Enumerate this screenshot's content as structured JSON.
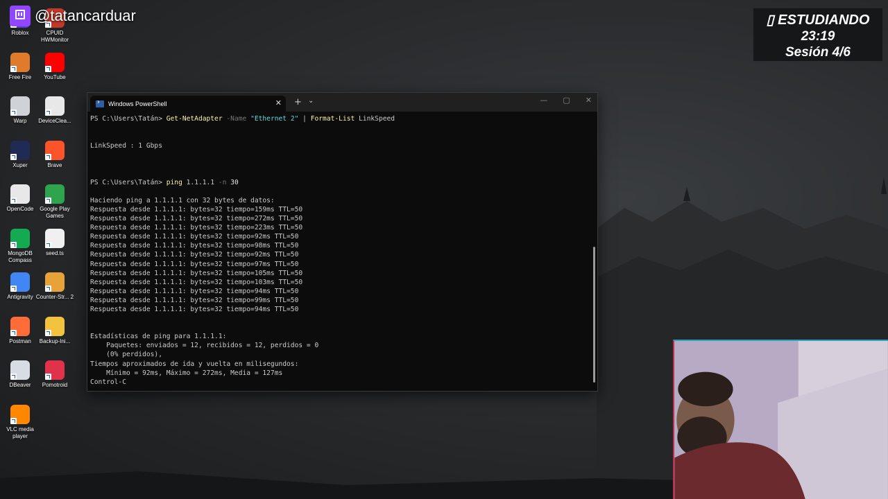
{
  "overlay": {
    "twitch_handle": "@tatancarduar",
    "status_line1": "▯ ESTUDIANDO",
    "status_time": "23:19",
    "status_session": "Sesión 4/6"
  },
  "desktop_icons": [
    {
      "label": "Roblox",
      "icon": "roblox-icon",
      "color": "#5b3fd0"
    },
    {
      "label": "CPUID HWMonitor",
      "icon": "hwmonitor-icon",
      "color": "#c0392b"
    },
    {
      "label": "Free Fire",
      "icon": "freefire-icon",
      "color": "#e07b2b"
    },
    {
      "label": "YouTube",
      "icon": "youtube-icon",
      "color": "#ff0000"
    },
    {
      "label": "Warp",
      "icon": "warp-icon",
      "color": "#cfd3d8"
    },
    {
      "label": "DeviceClea...",
      "icon": "file-icon",
      "color": "#e8e8e8"
    },
    {
      "label": "Xuper",
      "icon": "xuper-icon",
      "color": "#1f2a55"
    },
    {
      "label": "Brave",
      "icon": "brave-icon",
      "color": "#fb542b"
    },
    {
      "label": "OpenCode",
      "icon": "opencode-icon",
      "color": "#e8e8e8"
    },
    {
      "label": "Google Play Games",
      "icon": "google-play-games-icon",
      "color": "#2ea44f"
    },
    {
      "label": "MongoDB Compass",
      "icon": "mongodb-icon",
      "color": "#13aa52"
    },
    {
      "label": "seed.ts",
      "icon": "file-icon",
      "color": "#f0f0f0"
    },
    {
      "label": "Antigravity",
      "icon": "antigravity-icon",
      "color": "#4285f4"
    },
    {
      "label": "Counter-Str... 2",
      "icon": "counter-strike-icon",
      "color": "#e7a33a"
    },
    {
      "label": "Postman",
      "icon": "postman-icon",
      "color": "#ff6c37"
    },
    {
      "label": "Backup-Ini...",
      "icon": "folder-icon",
      "color": "#f3c33f"
    },
    {
      "label": "DBeaver",
      "icon": "dbeaver-icon",
      "color": "#d8dde3"
    },
    {
      "label": "Pomotroid",
      "icon": "pomotroid-icon",
      "color": "#e0334b"
    },
    {
      "label": "VLC media player",
      "icon": "vlc-icon",
      "color": "#ff8800"
    }
  ],
  "terminal": {
    "tab_title": "Windows PowerShell",
    "new_tab": "+",
    "dropdown": "⌄",
    "minimize": "—",
    "maximize": "▢",
    "close": "✕",
    "prompt": "PS C:\\Users\\Tatán>",
    "cmd1": {
      "name": "Get-NetAdapter",
      "p1": "-Name",
      "v1": "\"Ethernet 2\"",
      "pipe": "|",
      "name2": "Format-List",
      "arg": "LinkSpeed"
    },
    "linkspeed": "LinkSpeed : 1 Gbps",
    "cmd2": {
      "name": "ping",
      "host": "1.1.1.1",
      "p1": "-n",
      "v1": "30"
    },
    "ping_header": "Haciendo ping a 1.1.1.1 con 32 bytes de datos:",
    "ping_lines": [
      "Respuesta desde 1.1.1.1: bytes=32 tiempo=159ms TTL=50",
      "Respuesta desde 1.1.1.1: bytes=32 tiempo=272ms TTL=50",
      "Respuesta desde 1.1.1.1: bytes=32 tiempo=223ms TTL=50",
      "Respuesta desde 1.1.1.1: bytes=32 tiempo=92ms TTL=50",
      "Respuesta desde 1.1.1.1: bytes=32 tiempo=98ms TTL=50",
      "Respuesta desde 1.1.1.1: bytes=32 tiempo=92ms TTL=50",
      "Respuesta desde 1.1.1.1: bytes=32 tiempo=97ms TTL=50",
      "Respuesta desde 1.1.1.1: bytes=32 tiempo=105ms TTL=50",
      "Respuesta desde 1.1.1.1: bytes=32 tiempo=103ms TTL=50",
      "Respuesta desde 1.1.1.1: bytes=32 tiempo=94ms TTL=50",
      "Respuesta desde 1.1.1.1: bytes=32 tiempo=99ms TTL=50",
      "Respuesta desde 1.1.1.1: bytes=32 tiempo=94ms TTL=50"
    ],
    "stats": [
      "Estadísticas de ping para 1.1.1.1:",
      "    Paquetes: enviados = 12, recibidos = 12, perdidos = 0",
      "    (0% perdidos),",
      "Tiempos aproximados de ida y vuelta en milisegundos:",
      "    Mínimo = 92ms, Máximo = 272ms, Media = 127ms",
      "Control-C"
    ]
  }
}
